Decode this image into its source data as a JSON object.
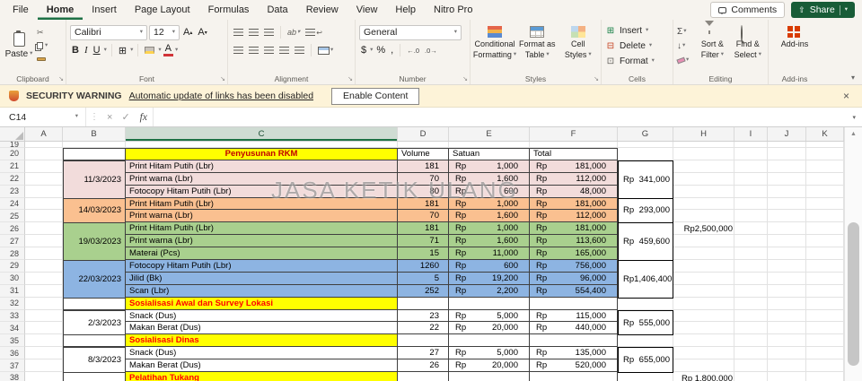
{
  "theme": {
    "accent_green": "#1e7145",
    "share_button_bg": "#185c37",
    "warning_bg": "#fdf3d8"
  },
  "titlebar": {
    "tabs": [
      {
        "label": "File",
        "active": false
      },
      {
        "label": "Home",
        "active": true
      },
      {
        "label": "Insert",
        "active": false
      },
      {
        "label": "Page Layout",
        "active": false
      },
      {
        "label": "Formulas",
        "active": false
      },
      {
        "label": "Data",
        "active": false
      },
      {
        "label": "Review",
        "active": false
      },
      {
        "label": "View",
        "active": false
      },
      {
        "label": "Help",
        "active": false
      },
      {
        "label": "Nitro Pro",
        "active": false
      }
    ],
    "comments_label": "Comments",
    "share_label": "Share"
  },
  "ribbon": {
    "group_labels": [
      "Clipboard",
      "Font",
      "Alignment",
      "Number",
      "Styles",
      "Cells",
      "Editing",
      "Add-ins"
    ],
    "paste_label": "Paste",
    "font_name": "Calibri",
    "font_size": "12",
    "number_format": "General",
    "styles_buttons": [
      {
        "line1": "Conditional",
        "line2": "Formatting"
      },
      {
        "line1": "Format as",
        "line2": "Table"
      },
      {
        "line1": "Cell",
        "line2": "Styles"
      }
    ],
    "cells_buttons": [
      "Insert",
      "Delete",
      "Format"
    ],
    "editing_buttons": [
      {
        "line1": "Sort &",
        "line2": "Filter"
      },
      {
        "line1": "Find &",
        "line2": "Select"
      }
    ],
    "addins_label": "Add-ins"
  },
  "security_bar": {
    "title": "SECURITY WARNING",
    "message": "Automatic update of links has been disabled",
    "button_label": "Enable Content"
  },
  "formula_bar": {
    "name_box": "C14",
    "fx_label": "fx",
    "formula": ""
  },
  "watermark": "JASA KETIK ULANG",
  "sheet": {
    "columns": [
      "A",
      "B",
      "C",
      "D",
      "E",
      "F",
      "G",
      "H",
      "I",
      "J",
      "K"
    ],
    "active_column": "C",
    "currency": "Rp",
    "colors": {
      "pink": "#f2dcdb",
      "orange": "#fac090",
      "green": "#a9d08e",
      "blue": "#8db4e2",
      "yellow": "#ffff00",
      "section_text": "#ff0000",
      "title_text": "#c00000"
    },
    "rows": [
      {
        "num": 19,
        "type": "blank",
        "h": 7
      },
      {
        "num": 20,
        "type": "head",
        "c": "Penyusunan RKM",
        "d": "Volume",
        "e": "Satuan",
        "f": "Total"
      },
      {
        "num": 21,
        "type": "item",
        "bg": "pink",
        "c": "Print Hitam Putih (Lbr)",
        "d": "181",
        "e": "1,000",
        "f": "181,000"
      },
      {
        "num": 22,
        "type": "item",
        "bg": "pink",
        "c": "Print warna (Lbr)",
        "d": "70",
        "e": "1,600",
        "f": "112,000"
      },
      {
        "num": 23,
        "type": "item",
        "bg": "pink",
        "c": "Fotocopy Hitam Putih (Lbr)",
        "d": "80",
        "e": "600",
        "f": "48,000"
      },
      {
        "num": 24,
        "type": "item",
        "bg": "orange",
        "c": "Print Hitam Putih (Lbr)",
        "d": "181",
        "e": "1,000",
        "f": "181,000"
      },
      {
        "num": 25,
        "type": "item",
        "bg": "orange",
        "c": "Print warna (Lbr)",
        "d": "70",
        "e": "1,600",
        "f": "112,000"
      },
      {
        "num": 26,
        "type": "item",
        "bg": "green",
        "c": "Print Hitam Putih (Lbr)",
        "d": "181",
        "e": "1,000",
        "f": "181,000"
      },
      {
        "num": 27,
        "type": "item",
        "bg": "green",
        "c": "Print warna (Lbr)",
        "d": "71",
        "e": "1,600",
        "f": "113,600"
      },
      {
        "num": 28,
        "type": "item",
        "bg": "green",
        "c": "Materai (Pcs)",
        "d": "15",
        "e": "11,000",
        "f": "165,000"
      },
      {
        "num": 29,
        "type": "item",
        "bg": "blue",
        "c": "Fotocopy Hitam Putih (Lbr)",
        "d": "1260",
        "e": "600",
        "f": "756,000"
      },
      {
        "num": 30,
        "type": "item",
        "bg": "blue",
        "c": "Jilid (Bk)",
        "d": "5",
        "e": "19,200",
        "f": "96,000"
      },
      {
        "num": 31,
        "type": "item",
        "bg": "blue",
        "c": "Scan (Lbr)",
        "d": "252",
        "e": "2,200",
        "f": "554,400"
      },
      {
        "num": 32,
        "type": "section",
        "c": "Sosialisasi Awal dan Survey Lokasi"
      },
      {
        "num": 33,
        "type": "item",
        "c": "Snack (Dus)",
        "d": "23",
        "e": "5,000",
        "f": "115,000"
      },
      {
        "num": 34,
        "type": "item",
        "c": "Makan Berat (Dus)",
        "d": "22",
        "e": "20,000",
        "f": "440,000"
      },
      {
        "num": 35,
        "type": "section",
        "c": "Sosialisasi Dinas"
      },
      {
        "num": 36,
        "type": "item",
        "c": "Snack (Dus)",
        "d": "27",
        "e": "5,000",
        "f": "135,000"
      },
      {
        "num": 37,
        "type": "item",
        "c": "Makan Berat (Dus)",
        "d": "26",
        "e": "20,000",
        "f": "520,000"
      },
      {
        "num": 38,
        "type": "section",
        "c": "Pelatihan Tukang"
      }
    ],
    "date_merges": [
      {
        "text": "11/3/2023",
        "from": 21,
        "to": 23
      },
      {
        "text": "14/03/2023",
        "from": 24,
        "to": 25
      },
      {
        "text": "19/03/2023",
        "from": 26,
        "to": 28
      },
      {
        "text": "22/03/2023",
        "from": 29,
        "to": 31
      },
      {
        "text": "2/3/2023",
        "from": 33,
        "to": 34
      },
      {
        "text": "8/3/2023",
        "from": 36,
        "to": 37
      }
    ],
    "total_merges": [
      {
        "value": "341,000",
        "from": 21,
        "to": 23
      },
      {
        "value": "293,000",
        "from": 24,
        "to": 25
      },
      {
        "value": "459,600",
        "from": 26,
        "to": 28
      },
      {
        "value": "1,406,400",
        "from": 29,
        "to": 31
      },
      {
        "value": "555,000",
        "from": 33,
        "to": 34
      },
      {
        "value": "655,000",
        "from": 36,
        "to": 37
      }
    ],
    "side_notes": [
      {
        "text": "Rp2,500,000",
        "row": 26
      },
      {
        "text": "Rp 1,800,000",
        "row": 38
      }
    ]
  }
}
